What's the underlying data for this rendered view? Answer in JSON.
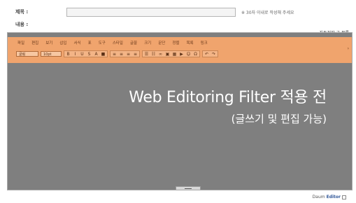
{
  "form": {
    "title_label": "제목 :",
    "title_value": "",
    "title_hint": "※ 30자 이내로 작성해 주세요",
    "content_label": "내용 :"
  },
  "editor": {
    "top_links": "자동저장 글 목록",
    "menu": [
      "파일",
      "편집",
      "보기",
      "삽입",
      "서식",
      "표",
      "도구",
      "스타일",
      "글꼴",
      "크기",
      "문단",
      "정렬",
      "목록",
      "링크"
    ],
    "font_select": "굴림",
    "size_select": "10pt",
    "toolbar_buttons": [
      {
        "name": "bold-icon",
        "glyph": "B"
      },
      {
        "name": "italic-icon",
        "glyph": "I"
      },
      {
        "name": "underline-icon",
        "glyph": "U"
      },
      {
        "name": "strike-icon",
        "glyph": "S"
      },
      {
        "name": "font-color-icon",
        "glyph": "A"
      },
      {
        "name": "bg-color-icon",
        "glyph": "■"
      }
    ],
    "align_buttons": [
      {
        "name": "align-left-icon",
        "glyph": "≡"
      },
      {
        "name": "align-center-icon",
        "glyph": "≡"
      },
      {
        "name": "align-right-icon",
        "glyph": "≡"
      },
      {
        "name": "align-justify-icon",
        "glyph": "≡"
      }
    ],
    "insert_buttons": [
      {
        "name": "list-icon",
        "glyph": "☰"
      },
      {
        "name": "numbered-list-icon",
        "glyph": "☷"
      },
      {
        "name": "link-icon",
        "glyph": "∞"
      },
      {
        "name": "image-icon",
        "glyph": "▣"
      },
      {
        "name": "table-icon",
        "glyph": "▦"
      },
      {
        "name": "video-icon",
        "glyph": "▶"
      },
      {
        "name": "emoticon-icon",
        "glyph": "☺"
      },
      {
        "name": "special-char-icon",
        "glyph": "Ω"
      }
    ],
    "history_buttons": [
      {
        "name": "undo-icon",
        "glyph": "↶"
      },
      {
        "name": "redo-icon",
        "glyph": "↷"
      }
    ]
  },
  "overlay": {
    "title": "Web Editoring Filter 적용 전",
    "subtitle": "(글쓰기 및 편집 가능)"
  },
  "footer": {
    "prefix": "Daum",
    "brand": "Editor"
  }
}
